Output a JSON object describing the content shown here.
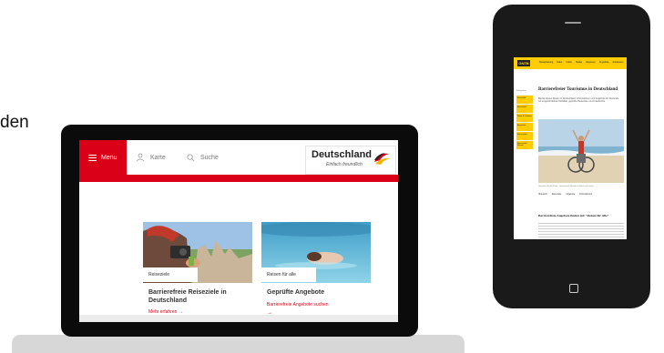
{
  "caption_fragment": "den",
  "laptop": {
    "header": {
      "menu_label": "Menu",
      "karte_label": "Karte",
      "suche_label": "Suche",
      "logo_title": "Deutschland",
      "logo_subtitle": "Einfach freundlich"
    },
    "cards": [
      {
        "tag": "Reiseziele",
        "title": "Barrierefreie Reiseziele in Deutschland",
        "link": "Mehr erfahren →"
      },
      {
        "tag": "Reisen für alle",
        "title": "Geprüfte Angebote",
        "link": "Barrierefreie Angebote suchen",
        "arrow": "→"
      }
    ]
  },
  "tablet": {
    "logo": "GNTB",
    "nav": [
      "Reiseplanung",
      "Natur",
      "Kultur",
      "Städte",
      "Regionen",
      "Angebote",
      "Entdecken"
    ],
    "sidebar": {
      "heading": "Kategorien",
      "items": [
        "Startseite",
        "Reiseziele",
        "Natur & Outdoor",
        "Angebote",
        "Barrierefrei",
        "Barrierefrei Reisen"
      ]
    },
    "title": "Barrierefreier Tourismus in Deutschland",
    "intro": "Barrierefreies Reisen in Deutschland: Informationen und Angebote für Reisende mit eingeschränkter Mobilität, geprüfte Reiseziele und Unterkünfte.",
    "photo_caption": "Genießen Sie die Küste – barrierefreie Strände an Nord- und Ostsee",
    "tabs": [
      "Übersicht",
      "Reiseziele",
      "Angebote",
      "Informationen"
    ],
    "subheading": "Barrierefreie Angebote finden mit \"Reisen für Alle\""
  },
  "colors": {
    "brand_red": "#d90018",
    "tablet_yellow": "#ffcc00"
  }
}
